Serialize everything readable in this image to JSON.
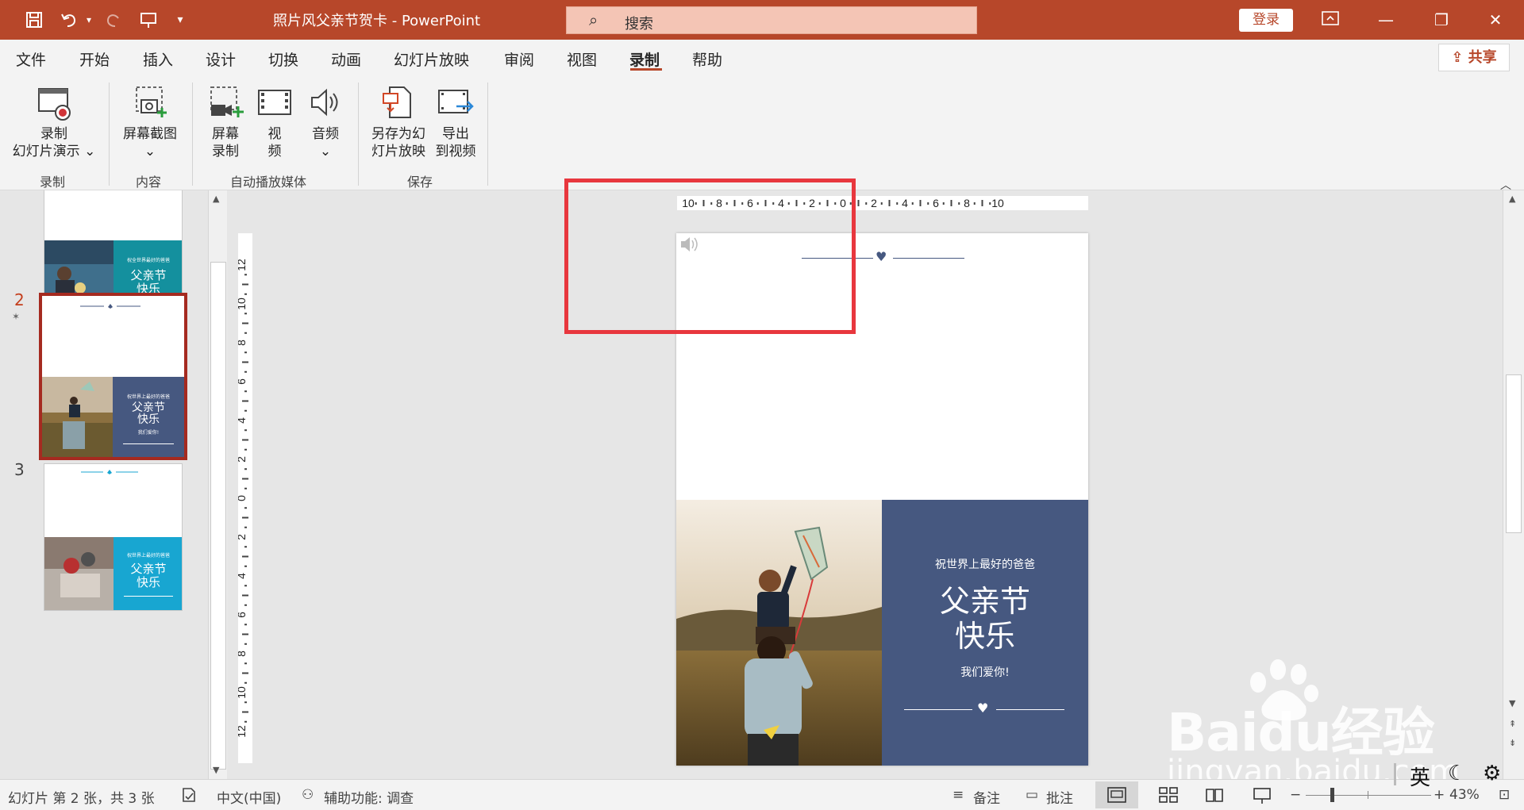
{
  "titlebar": {
    "doc_title": "照片风父亲节贺卡 - PowerPoint",
    "search_placeholder": "搜索",
    "login": "登录"
  },
  "tabs": [
    "文件",
    "开始",
    "插入",
    "设计",
    "切换",
    "动画",
    "幻灯片放映",
    "审阅",
    "视图",
    "录制",
    "帮助"
  ],
  "active_tab": "录制",
  "share": "共享",
  "ribbon": {
    "record_slideshow": [
      "录制",
      "幻灯片演示"
    ],
    "screenshot": "屏幕截图",
    "screen_record": [
      "屏幕",
      "录制"
    ],
    "video": [
      "视",
      "频"
    ],
    "audio": "音频",
    "save_as_show": [
      "另存为幻",
      "灯片放映"
    ],
    "export_video": [
      "导出",
      "到视频"
    ],
    "groups": [
      "录制",
      "内容",
      "自动播放媒体",
      "保存"
    ]
  },
  "thumbnails": {
    "slide_numbers": [
      "2",
      "3"
    ],
    "slide1_text": [
      "祝全世界最好的爸爸",
      "父亲节",
      "快乐"
    ],
    "slide2_text": [
      "祝世界上最好的爸爸",
      "父亲节",
      "快乐",
      "我们爱你!"
    ],
    "slide3_text": [
      "祝世界上最好的爸爸",
      "父亲节",
      "快乐"
    ]
  },
  "ruler": {
    "h_ticks": [
      "10",
      "8",
      "6",
      "4",
      "2",
      "0",
      "2",
      "4",
      "6",
      "8",
      "10"
    ],
    "v_ticks": [
      "12",
      "10",
      "8",
      "6",
      "4",
      "2",
      "0",
      "2",
      "4",
      "6",
      "8",
      "10",
      "12"
    ]
  },
  "slide": {
    "subtitle": "祝世界上最好的爸爸",
    "title_line1": "父亲节",
    "title_line2": "快乐",
    "love": "我们爱你!"
  },
  "statusbar": {
    "slide_info": "幻灯片 第 2 张，共 3 张",
    "language": "中文(中国)",
    "accessibility": "辅助功能: 调查",
    "notes": "备注",
    "comments": "批注",
    "zoom": "43%"
  },
  "watermark": {
    "brand": "Baidu经验",
    "url": "jingyan.baidu.com"
  },
  "ime": "英",
  "colors": {
    "accent": "#b7472a",
    "slide_panel": "#465880",
    "highlight_box": "#e8373e",
    "thumb3_panel": "#18a6d1",
    "thumb1_panel": "#14909e"
  }
}
